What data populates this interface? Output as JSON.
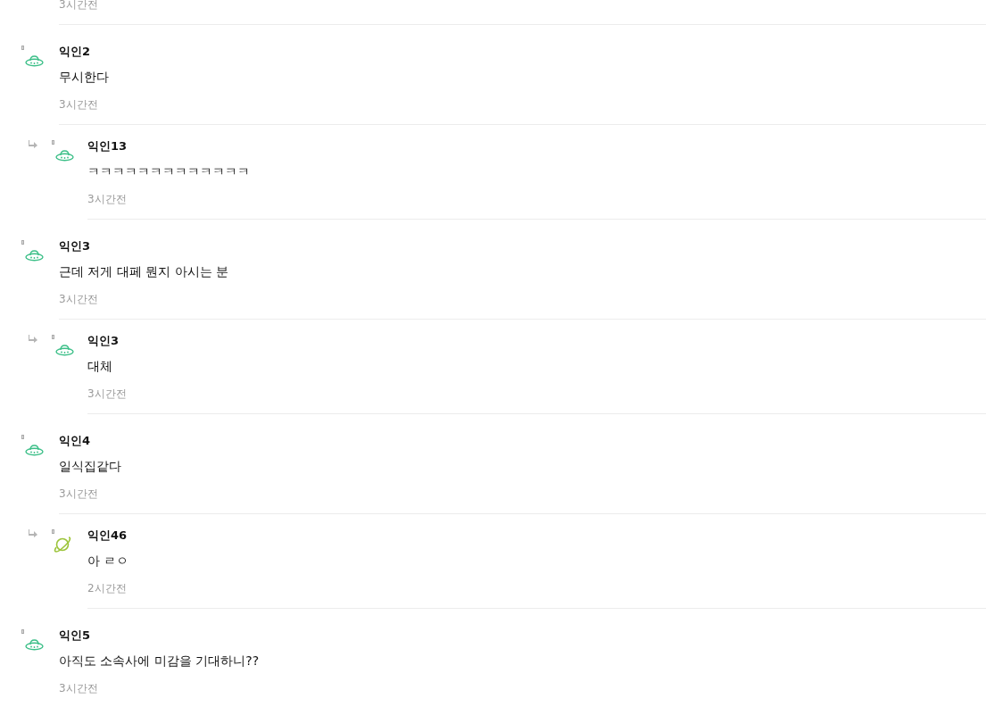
{
  "top_partial": {
    "time": "3시간전"
  },
  "comments": [
    {
      "kind": "comment",
      "avatar": {
        "kind": "ufo",
        "color": "#3cbf88"
      },
      "name": "익인2",
      "body": "무시한다",
      "time": "3시간전"
    },
    {
      "kind": "reply",
      "avatar": {
        "kind": "ufo",
        "color": "#3cbf88"
      },
      "name": "익인13",
      "body": "ㅋㅋㅋㅋㅋㅋㅋㅋㅋㅋㅋㅋㅋ",
      "time": "3시간전"
    },
    {
      "kind": "comment",
      "avatar": {
        "kind": "ufo",
        "color": "#3cbf88"
      },
      "name": "익인3",
      "body": "근데 저게 대페 뭔지 아시는 분",
      "time": "3시간전"
    },
    {
      "kind": "reply",
      "avatar": {
        "kind": "ufo",
        "color": "#3cbf88"
      },
      "name": "익인3",
      "body": "대체",
      "time": "3시간전"
    },
    {
      "kind": "comment",
      "avatar": {
        "kind": "ufo",
        "color": "#3cbf88"
      },
      "name": "익인4",
      "body": "일식집같다",
      "time": "3시간전"
    },
    {
      "kind": "reply",
      "avatar": {
        "kind": "planet",
        "color": "#9cc43a"
      },
      "name": "익인46",
      "body": "아 ㄹㅇ",
      "time": "2시간전"
    },
    {
      "kind": "comment",
      "avatar": {
        "kind": "ufo",
        "color": "#3cbf88"
      },
      "name": "익인5",
      "body": "아직도 소속사에 미감을 기대하니??",
      "time": "3시간전"
    }
  ]
}
